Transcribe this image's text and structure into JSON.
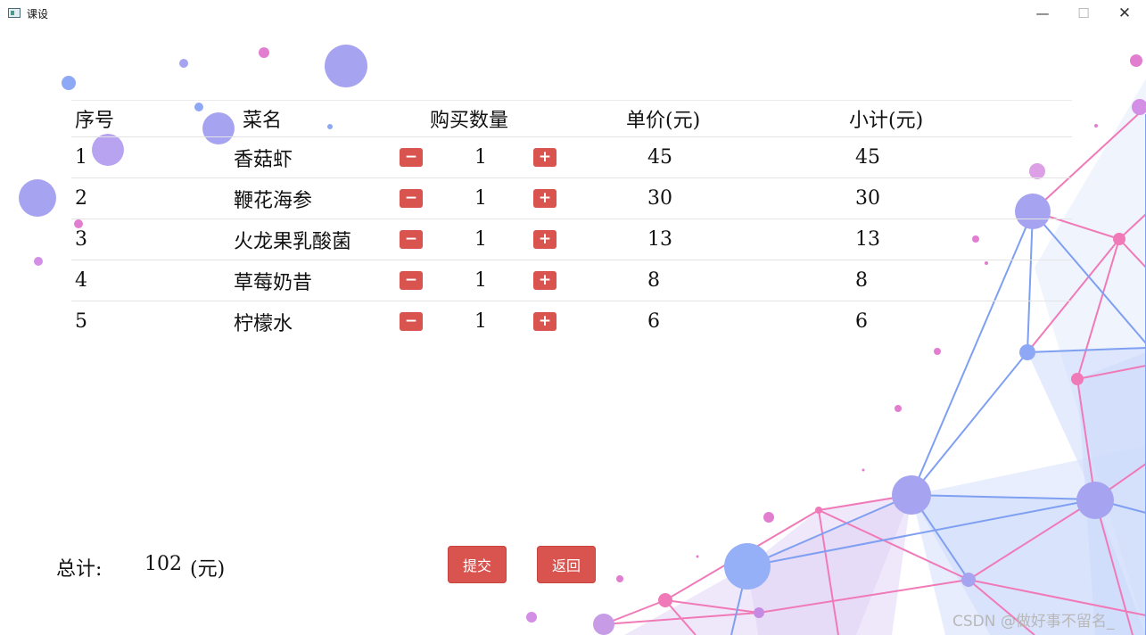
{
  "window": {
    "title": "课设",
    "icons": {
      "app": "app-icon",
      "minimize": "minimize-icon",
      "maximize": "maximize-icon",
      "close": "close-icon"
    }
  },
  "table": {
    "headers": {
      "no": "序号",
      "name": "菜名",
      "quantity": "购买数量",
      "price": "单价(元)",
      "subtotal": "小计(元)"
    },
    "rows": [
      {
        "no": "1",
        "name": "香菇虾",
        "qty": "1",
        "price": "45",
        "subtotal": "45"
      },
      {
        "no": "2",
        "name": "鞭花海参",
        "qty": "1",
        "price": "30",
        "subtotal": "30"
      },
      {
        "no": "3",
        "name": "火龙果乳酸菌",
        "qty": "1",
        "price": "13",
        "subtotal": "13"
      },
      {
        "no": "4",
        "name": "草莓奶昔",
        "qty": "1",
        "price": "8",
        "subtotal": "8"
      },
      {
        "no": "5",
        "name": "柠檬水",
        "qty": "1",
        "price": "6",
        "subtotal": "6"
      }
    ],
    "minus_label": "−",
    "plus_label": "+"
  },
  "footer": {
    "total_label": "总计:",
    "total_value": "102",
    "total_unit": "(元)",
    "submit_label": "提交",
    "back_label": "返回"
  },
  "watermark": "CSDN @做好事不留名_",
  "colors": {
    "button": "#d9534f",
    "network_pink": "#f07ab8",
    "network_blue": "#7f9ff2",
    "node_purple": "#a6a3f0"
  }
}
